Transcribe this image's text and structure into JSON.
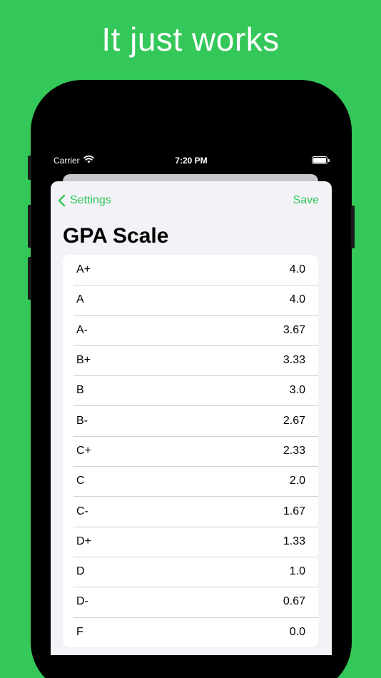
{
  "headline": "It just works",
  "status_bar": {
    "carrier": "Carrier",
    "time": "7:20 PM"
  },
  "nav": {
    "back_label": "Settings",
    "save_label": "Save"
  },
  "title": "GPA Scale",
  "grades": [
    {
      "grade": "A+",
      "value": "4.0"
    },
    {
      "grade": "A",
      "value": "4.0"
    },
    {
      "grade": "A-",
      "value": "3.67"
    },
    {
      "grade": "B+",
      "value": "3.33"
    },
    {
      "grade": "B",
      "value": "3.0"
    },
    {
      "grade": "B-",
      "value": "2.67"
    },
    {
      "grade": "C+",
      "value": "2.33"
    },
    {
      "grade": "C",
      "value": "2.0"
    },
    {
      "grade": "C-",
      "value": "1.67"
    },
    {
      "grade": "D+",
      "value": "1.33"
    },
    {
      "grade": "D",
      "value": "1.0"
    },
    {
      "grade": "D-",
      "value": "0.67"
    },
    {
      "grade": "F",
      "value": "0.0"
    }
  ],
  "colors": {
    "accent": "#34C759",
    "background": "#34C759",
    "sheet": "#F2F2F7"
  }
}
